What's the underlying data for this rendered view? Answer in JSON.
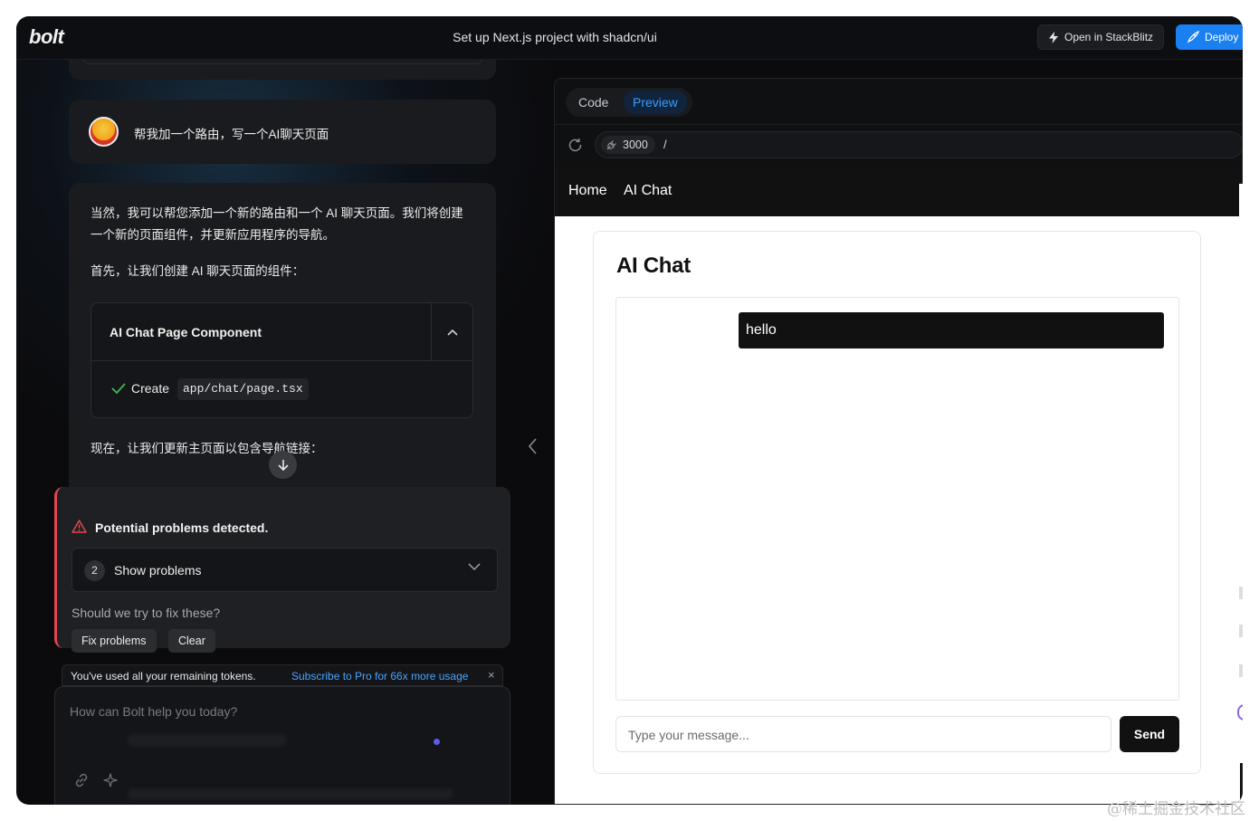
{
  "app": {
    "logo": "bolt",
    "project_title": "Set up Next.js project with shadcn/ui",
    "open_stackblitz_label": "Open in StackBlitz",
    "deploy_label": "Deploy"
  },
  "chat": {
    "user_message": "帮我加一个路由，写一个AI聊天页面",
    "ai_paragraph_1": "当然，我可以帮您添加一个新的路由和一个 AI 聊天页面。我们将创建一个新的页面组件，并更新应用程序的导航。",
    "ai_paragraph_2": "首先，让我们创建 AI 聊天页面的组件：",
    "artifact": {
      "title": "AI Chat Page Component",
      "action_label": "Create",
      "file_path": "app/chat/page.tsx"
    },
    "ai_paragraph_3": "现在，让我们更新主页面以包含导航链接："
  },
  "problems": {
    "title": "Potential problems detected.",
    "count": "2",
    "show_label": "Show problems",
    "question": "Should we try to fix these?",
    "fix_button": "Fix problems",
    "clear_button": "Clear"
  },
  "tokens": {
    "message": "You've used all your remaining tokens.",
    "link": "Subscribe to Pro for 66x more usage",
    "close": "×"
  },
  "prompt": {
    "placeholder": "How can Bolt help you today?"
  },
  "preview": {
    "tab_code": "Code",
    "tab_preview": "Preview",
    "port": "3000",
    "path": "/",
    "site": {
      "nav": [
        "Home",
        "AI Chat"
      ],
      "title": "AI Chat",
      "messages": [
        "hello"
      ],
      "input_placeholder": "Type your message...",
      "send_label": "Send"
    }
  },
  "watermark": "@稀土掘金技术社区",
  "colors": {
    "accent_blue": "#1a7ff0",
    "link_blue": "#4aa3ff",
    "warning_red": "#e0484c",
    "check_green": "#3fb950"
  }
}
